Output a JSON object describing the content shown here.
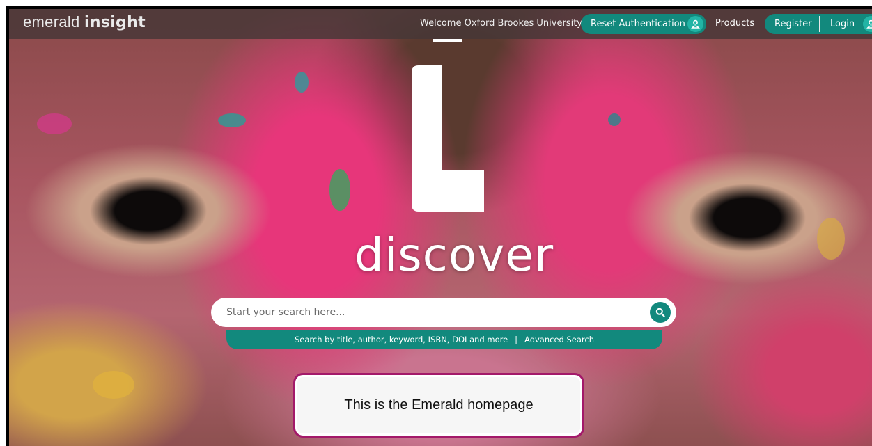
{
  "header": {
    "logo_light": "emerald",
    "logo_bold": "insight",
    "welcome": "Welcome Oxford Brookes University",
    "reset_auth_label": "Reset Authentication",
    "products_label": "Products",
    "register_label": "Register",
    "login_label": "Login"
  },
  "hero": {
    "tagline": "discover"
  },
  "search": {
    "placeholder": "Start your search here...",
    "hint": "Search by title, author, keyword, ISBN, DOI and more",
    "separator": "|",
    "advanced_label": "Advanced Search"
  },
  "overlay": {
    "caption": "This is the Emerald homepage"
  },
  "colors": {
    "accent": "#12897d",
    "accent_light": "#22b4a5",
    "caption_border": "#a3196a"
  },
  "icons": [
    "user-icon",
    "search-icon"
  ]
}
